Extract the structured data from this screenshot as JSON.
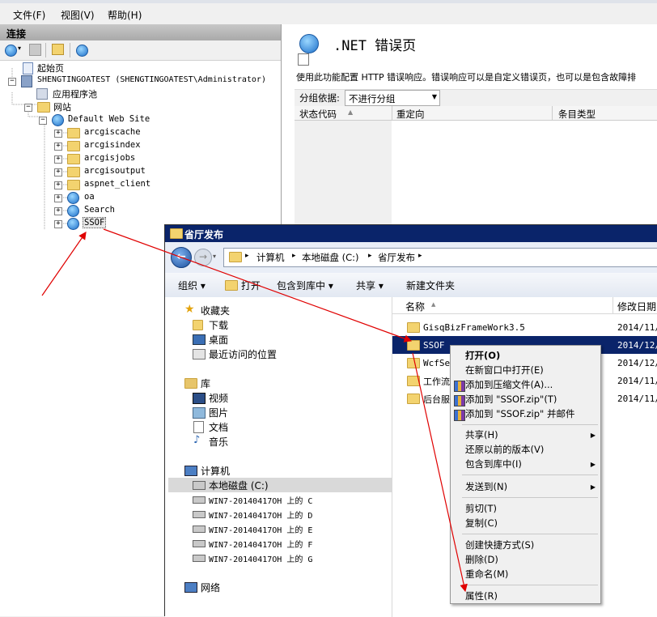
{
  "iis": {
    "menu": [
      "文件(F)",
      "视图(V)",
      "帮助(H)"
    ],
    "connections_title": "连接",
    "tree": {
      "start_page": "起始页",
      "server": "SHENGTINGOATEST (SHENGTINGOATEST\\Administrator)",
      "app_pools": "应用程序池",
      "sites": "网站",
      "default_site": "Default Web Site",
      "children": [
        "arcgiscache",
        "arcgisindex",
        "arcgisjobs",
        "arcgisoutput",
        "aspnet_client",
        "oa",
        "Search",
        "SSOF"
      ]
    },
    "feature": {
      "title": ".NET 错误页",
      "description": "使用此功能配置 HTTP 错误响应。错误响应可以是自定义错误页，也可以是包含故障排",
      "group_by_label": "分组依据:",
      "group_by_value": "不进行分组",
      "columns": [
        "状态代码",
        "重定向",
        "条目类型"
      ]
    }
  },
  "explorer": {
    "title": "省厅发布",
    "breadcrumb": [
      "计算机",
      "本地磁盘 (C:)",
      "省厅发布"
    ],
    "commands": [
      "组织",
      "打开",
      "包含到库中",
      "共享",
      "新建文件夹"
    ],
    "nav": {
      "favorites": "收藏夹",
      "favorite_items": [
        "下载",
        "桌面",
        "最近访问的位置"
      ],
      "libraries": "库",
      "library_items": [
        "视频",
        "图片",
        "文档",
        "音乐"
      ],
      "computer": "计算机",
      "drives": [
        "本地磁盘 (C:)",
        "WIN7-20140417OH 上的 C",
        "WIN7-20140417OH 上的 D",
        "WIN7-20140417OH 上的 E",
        "WIN7-20140417OH 上的 F",
        "WIN7-20140417OH 上的 G"
      ],
      "network": "网络"
    },
    "columns": [
      "名称",
      "修改日期"
    ],
    "files": [
      {
        "name": "GisqBizFrameWork3.5",
        "date": "2014/11/1"
      },
      {
        "name": "SSOF",
        "date": "2014/12/0"
      },
      {
        "name": "WcfSer",
        "date": "2014/12/0"
      },
      {
        "name": "工作流",
        "date": "2014/11/"
      },
      {
        "name": "后台服",
        "date": "2014/11/1"
      }
    ]
  },
  "context_menu": {
    "open": "打开(O)",
    "open_new_window": "在新窗口中打开(E)",
    "add_archive": "添加到压缩文件(A)...",
    "add_zip": "添加到 \"SSOF.zip\"(T)",
    "add_zip_mail": "添加到 \"SSOF.zip\" 并邮件",
    "share": "共享(H)",
    "restore": "还原以前的版本(V)",
    "include_library": "包含到库中(I)",
    "send_to": "发送到(N)",
    "cut": "剪切(T)",
    "copy": "复制(C)",
    "create_shortcut": "创建快捷方式(S)",
    "delete": "删除(D)",
    "rename": "重命名(M)",
    "properties": "属性(R)"
  },
  "colors": {
    "annotation": "#e00000",
    "selection": "#0a246a",
    "title_bar": "#0a246a"
  }
}
